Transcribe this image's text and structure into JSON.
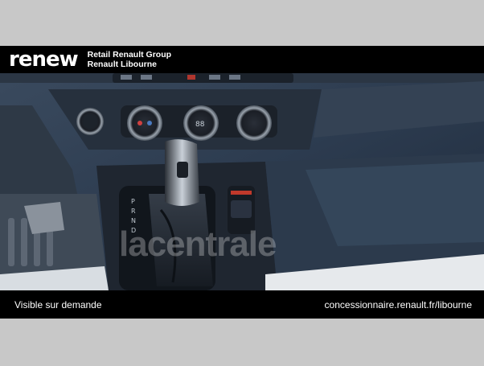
{
  "header": {
    "logo": "renew",
    "dealer_line1": "Retail Renault Group",
    "dealer_line2": "Renault Libourne"
  },
  "photo": {
    "watermark": "lacentrale",
    "subject": "car-interior-gear-shifter",
    "shifter_labels": [
      "P",
      "R",
      "N",
      "D"
    ]
  },
  "footer": {
    "left_text": "Visible sur demande",
    "right_text": "concessionnaire.renault.fr/libourne"
  },
  "colors": {
    "banner": "#000000",
    "background": "#c8c8c8",
    "dashboard": "#2a3a4e"
  }
}
